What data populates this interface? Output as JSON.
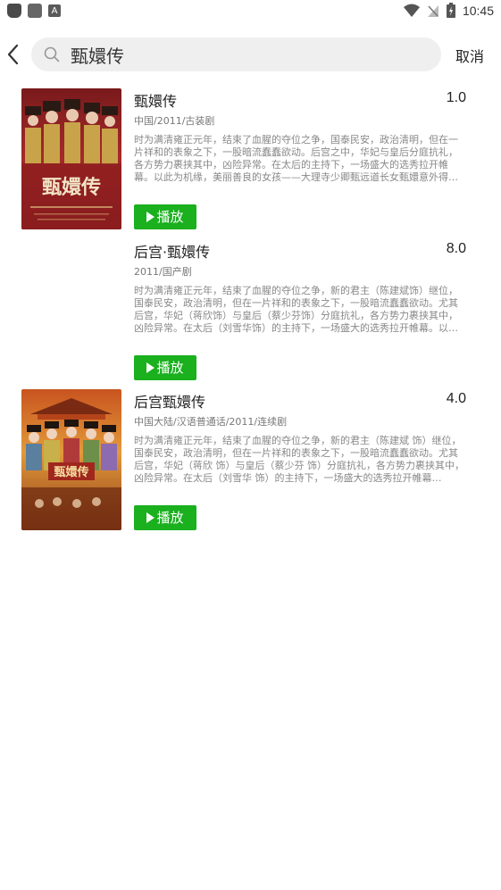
{
  "status_bar": {
    "time": "10:45"
  },
  "search": {
    "query": "甄嬛传",
    "cancel_label": "取消"
  },
  "results": [
    {
      "title": "甄嬛传",
      "rating": "1.0",
      "meta": "中国/2011/古装剧",
      "description": "时为满清雍正元年，结束了血腥的夺位之争，国泰民安，政治清明，但在一片祥和的表象之下，一股暗流蠢蠢欲动。后宫之中，华妃与皇后分庭抗礼，各方势力裹挟其中，凶险异常。在太后的主持下，一场盛大的选秀拉开帷幕。以此为机缘，美丽善良的女孩——大理寺少卿甄远道长女甄嬛意外得到…",
      "play_label": "播放",
      "has_poster": true
    },
    {
      "title": "后宫·甄嬛传",
      "rating": "8.0",
      "meta": "2011/国产剧",
      "description": "时为满清雍正元年，结束了血腥的夺位之争，新的君主（陈建斌饰）继位，国泰民安，政治清明，但在一片祥和的表象之下，一股暗流蠢蠢欲动。尤其后宫，华妃（蒋欣饰）与皇后（蔡少芬饰）分庭抗礼，各方势力裹挟其中，凶险异常。在太后（刘雪华饰）的主持下，一场盛大的选秀拉开帷幕。以…",
      "play_label": "播放",
      "has_poster": false
    },
    {
      "title": "后宫甄嬛传",
      "rating": "4.0",
      "meta": "中国大陆/汉语普通话/2011/连续剧",
      "description": "时为满清雍正元年，结束了血腥的夺位之争，新的君主（陈建斌 饰）继位，国泰民安，政治清明，但在一片祥和的表象之下，一股暗流蠢蠢欲动。尤其后宫，华妃（蒋欣 饰）与皇后（蔡少芬 饰）分庭抗礼，各方势力裹挟其中，凶险异常。在太后（刘雪华 饰）的主持下，一场盛大的选秀拉开帷幕…",
      "play_label": "播放",
      "has_poster": true
    }
  ],
  "colors": {
    "accent_green": "#1ab01e",
    "search_bg": "#efefef"
  },
  "icons": [
    "back-arrow-icon",
    "search-icon",
    "play-triangle-icon",
    "wifi-icon",
    "signal-icon",
    "battery-icon"
  ]
}
